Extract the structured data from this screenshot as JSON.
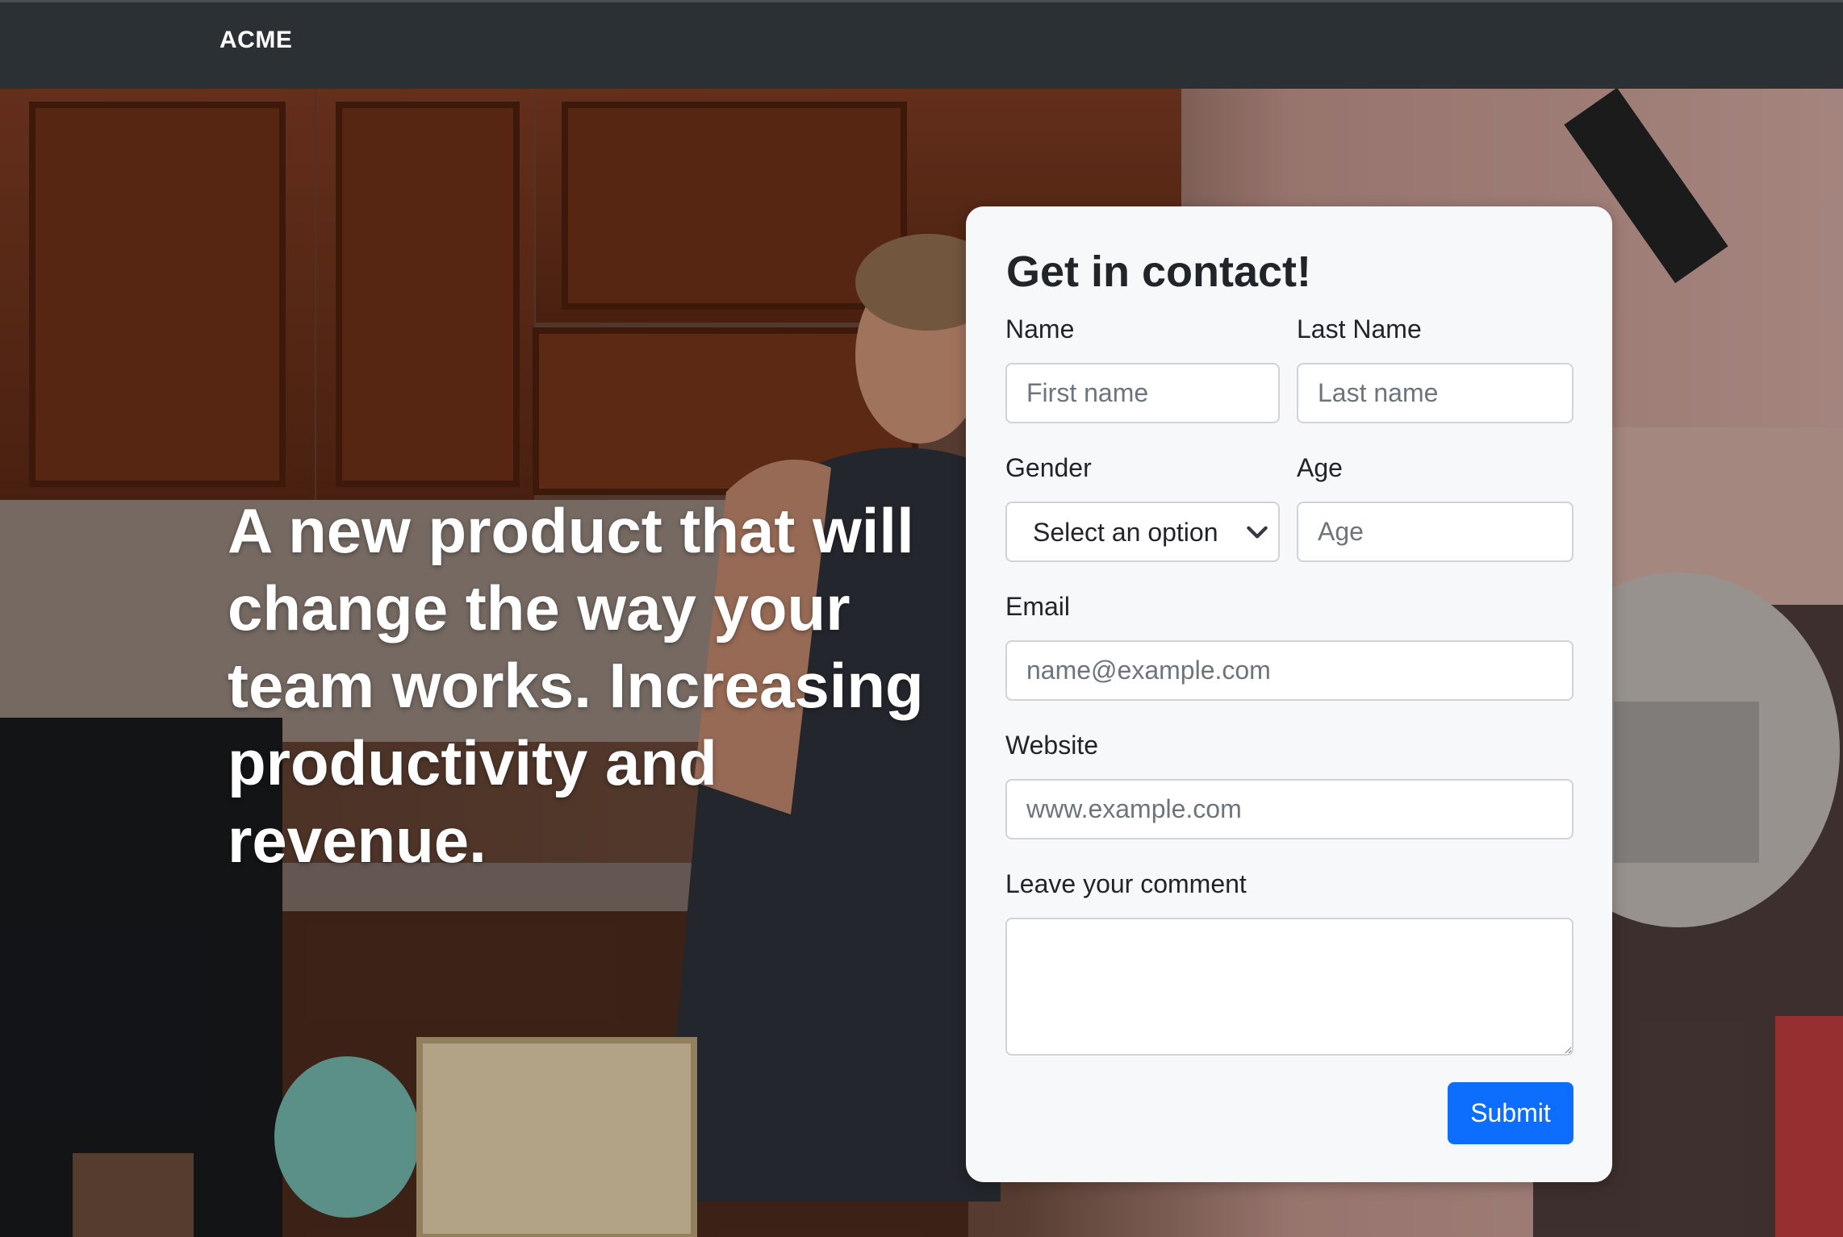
{
  "nav": {
    "brand": "ACME"
  },
  "hero": {
    "headline": "A new product that will change the way your team works. Increasing productivity and revenue."
  },
  "form": {
    "title": "Get in contact!",
    "name_label": "Name",
    "first_name_placeholder": "First name",
    "last_name_label": "Last Name",
    "last_name_placeholder": "Last name",
    "gender_label": "Gender",
    "gender_selected": "Select an option",
    "age_label": "Age",
    "age_placeholder": "Age",
    "email_label": "Email",
    "email_placeholder": "name@example.com",
    "website_label": "Website",
    "website_placeholder": "www.example.com",
    "comment_label": "Leave your comment",
    "submit_label": "Submit"
  },
  "colors": {
    "navbar": "#2b3035",
    "card": "#f7f8fa",
    "primary": "#0d6efd"
  }
}
